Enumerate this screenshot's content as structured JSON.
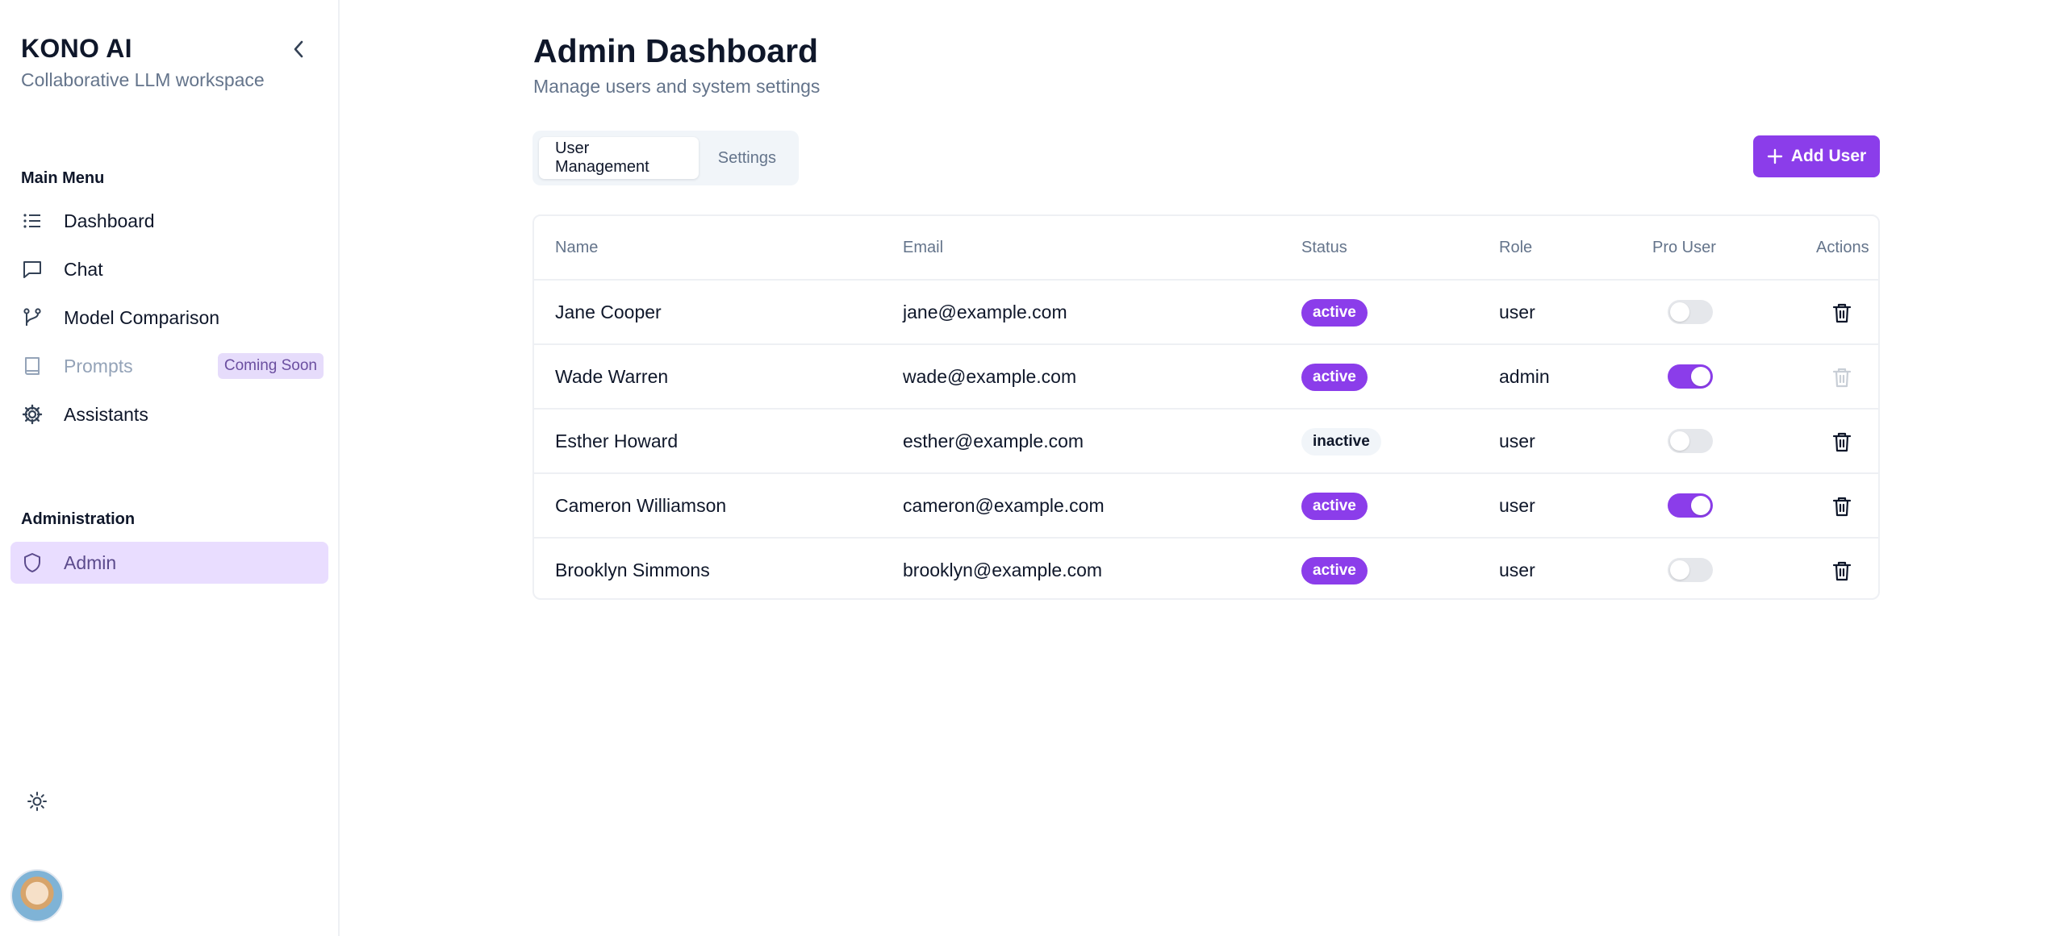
{
  "sidebar": {
    "brand_title": "KONO AI",
    "brand_subtitle": "Collaborative LLM workspace",
    "main_menu_label": "Main Menu",
    "items": [
      {
        "label": "Dashboard",
        "icon": "list-icon"
      },
      {
        "label": "Chat",
        "icon": "message-square-icon"
      },
      {
        "label": "Model Comparison",
        "icon": "git-branch-icon"
      },
      {
        "label": "Prompts",
        "icon": "book-icon",
        "badge": "Coming Soon",
        "disabled": true
      },
      {
        "label": "Assistants",
        "icon": "gear-icon"
      }
    ],
    "admin_section_label": "Administration",
    "admin_item": {
      "label": "Admin",
      "icon": "shield-icon",
      "active": true
    }
  },
  "header": {
    "title": "Admin Dashboard",
    "subtitle": "Manage users and system settings"
  },
  "tabs": [
    {
      "label": "User Management",
      "active": true
    },
    {
      "label": "Settings",
      "active": false
    }
  ],
  "add_user_label": "Add User",
  "table": {
    "columns": [
      "Name",
      "Email",
      "Status",
      "Role",
      "Pro User",
      "Actions"
    ],
    "rows": [
      {
        "name": "Jane Cooper",
        "email": "jane@example.com",
        "status": "active",
        "role": "user",
        "pro": false,
        "delete_enabled": true
      },
      {
        "name": "Wade Warren",
        "email": "wade@example.com",
        "status": "active",
        "role": "admin",
        "pro": true,
        "delete_enabled": false
      },
      {
        "name": "Esther Howard",
        "email": "esther@example.com",
        "status": "inactive",
        "role": "user",
        "pro": false,
        "delete_enabled": true
      },
      {
        "name": "Cameron Williamson",
        "email": "cameron@example.com",
        "status": "active",
        "role": "user",
        "pro": true,
        "delete_enabled": true
      },
      {
        "name": "Brooklyn Simmons",
        "email": "brooklyn@example.com",
        "status": "active",
        "role": "user",
        "pro": false,
        "delete_enabled": true
      }
    ]
  },
  "colors": {
    "accent": "#8b3dea",
    "active_nav_bg": "#e9ddff",
    "muted_text": "#64748b"
  }
}
